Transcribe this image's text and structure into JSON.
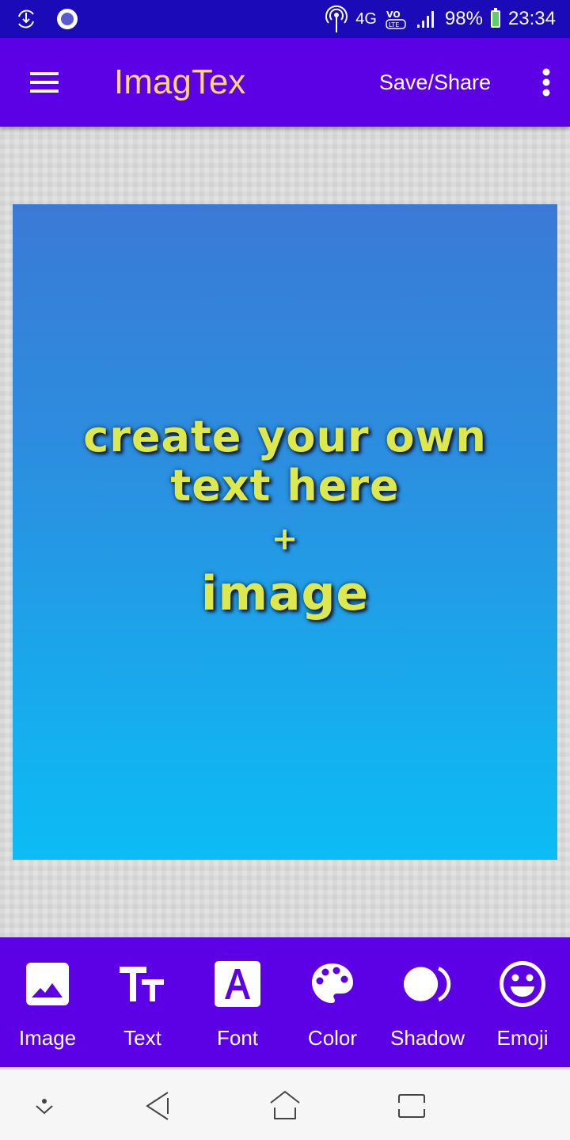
{
  "status_bar": {
    "time": "23:34",
    "battery": "98%",
    "network": "4G",
    "volte": "VoLTE",
    "icons": [
      "download-sync-icon",
      "record-dot-icon",
      "hotspot-icon",
      "network-4g-icon",
      "volte-icon",
      "signal-icon",
      "battery-icon"
    ]
  },
  "app_bar": {
    "title": "ImagTex",
    "save_share_label": "Save/Share",
    "title_color": "#ffd27a",
    "background_color": "#5c00e6"
  },
  "canvas": {
    "lines": [
      "create your own",
      "text here",
      "+",
      "image"
    ],
    "text_color": "#dde84e",
    "gradient_top": "#3a7ad6",
    "gradient_bottom": "#0cbcf4"
  },
  "toolbar": {
    "items": [
      {
        "label": "Image",
        "icon": "image-icon"
      },
      {
        "label": "Text",
        "icon": "text-size-icon"
      },
      {
        "label": "Font",
        "icon": "font-icon"
      },
      {
        "label": "Color",
        "icon": "palette-icon"
      },
      {
        "label": "Shadow",
        "icon": "shadow-icon"
      },
      {
        "label": "Emoji",
        "icon": "emoji-icon"
      }
    ]
  },
  "nav_bar": {
    "buttons": [
      "hide-nav",
      "back",
      "home",
      "recents"
    ]
  }
}
